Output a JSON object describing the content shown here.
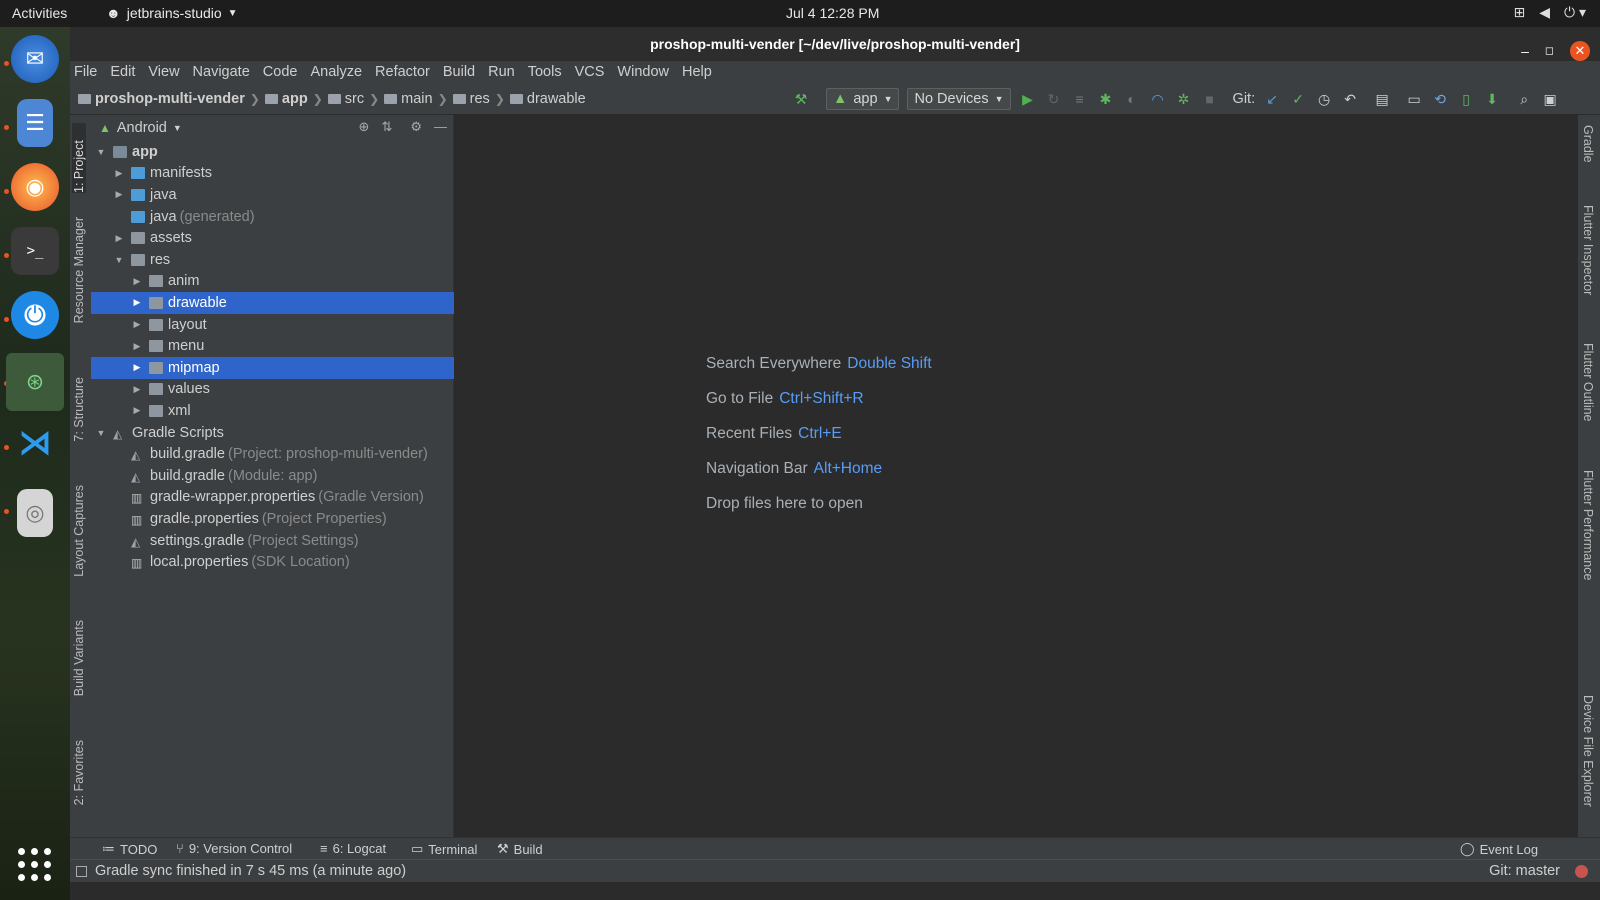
{
  "system": {
    "activities": "Activities",
    "app_name": "jetbrains-studio",
    "clock": "Jul 4  12:28 PM"
  },
  "window": {
    "title": "proshop-multi-vender [~/dev/live/proshop-multi-vender]"
  },
  "menubar": [
    "File",
    "Edit",
    "View",
    "Navigate",
    "Code",
    "Analyze",
    "Refactor",
    "Build",
    "Run",
    "Tools",
    "VCS",
    "Window",
    "Help"
  ],
  "breadcrumb": [
    "proshop-multi-vender",
    "app",
    "src",
    "main",
    "res",
    "drawable"
  ],
  "toolbar": {
    "run_config": "app",
    "device": "No Devices",
    "git_label": "Git:"
  },
  "left_tabs": [
    "1: Project",
    "Resource Manager",
    "7: Structure",
    "Layout Captures",
    "Build Variants",
    "2: Favorites"
  ],
  "right_tabs": [
    "Gradle",
    "Flutter Inspector",
    "Flutter Outline",
    "Flutter Performance",
    "Device File Explorer"
  ],
  "project": {
    "view_mode": "Android",
    "tree": [
      {
        "label": "app",
        "hint": "",
        "depth": 0,
        "arrow": "down",
        "icon": "folder-app",
        "selected": false,
        "bold": true
      },
      {
        "label": "manifests",
        "hint": "",
        "depth": 1,
        "arrow": "right",
        "icon": "folder-blue",
        "selected": false
      },
      {
        "label": "java",
        "hint": "",
        "depth": 1,
        "arrow": "right",
        "icon": "folder-blue",
        "selected": false
      },
      {
        "label": "java",
        "hint": "(generated)",
        "depth": 1,
        "arrow": "",
        "icon": "folder-blue",
        "selected": false
      },
      {
        "label": "assets",
        "hint": "",
        "depth": 1,
        "arrow": "right",
        "icon": "folder",
        "selected": false
      },
      {
        "label": "res",
        "hint": "",
        "depth": 1,
        "arrow": "down",
        "icon": "folder",
        "selected": false
      },
      {
        "label": "anim",
        "hint": "",
        "depth": 2,
        "arrow": "right",
        "icon": "folder",
        "selected": false
      },
      {
        "label": "drawable",
        "hint": "",
        "depth": 2,
        "arrow": "right",
        "icon": "folder",
        "selected": true
      },
      {
        "label": "layout",
        "hint": "",
        "depth": 2,
        "arrow": "right",
        "icon": "folder",
        "selected": false
      },
      {
        "label": "menu",
        "hint": "",
        "depth": 2,
        "arrow": "right",
        "icon": "folder",
        "selected": false
      },
      {
        "label": "mipmap",
        "hint": "",
        "depth": 2,
        "arrow": "right",
        "icon": "folder",
        "selected": true
      },
      {
        "label": "values",
        "hint": "",
        "depth": 2,
        "arrow": "right",
        "icon": "folder",
        "selected": false
      },
      {
        "label": "xml",
        "hint": "",
        "depth": 2,
        "arrow": "right",
        "icon": "folder",
        "selected": false
      },
      {
        "label": "Gradle Scripts",
        "hint": "",
        "depth": 0,
        "arrow": "down",
        "icon": "gradle",
        "selected": false
      },
      {
        "label": "build.gradle",
        "hint": "(Project: proshop-multi-vender)",
        "depth": 1,
        "arrow": "",
        "icon": "gradle",
        "selected": false
      },
      {
        "label": "build.gradle",
        "hint": "(Module: app)",
        "depth": 1,
        "arrow": "",
        "icon": "gradle",
        "selected": false
      },
      {
        "label": "gradle-wrapper.properties",
        "hint": "(Gradle Version)",
        "depth": 1,
        "arrow": "",
        "icon": "props",
        "selected": false
      },
      {
        "label": "gradle.properties",
        "hint": "(Project Properties)",
        "depth": 1,
        "arrow": "",
        "icon": "props",
        "selected": false
      },
      {
        "label": "settings.gradle",
        "hint": "(Project Settings)",
        "depth": 1,
        "arrow": "",
        "icon": "gradle",
        "selected": false
      },
      {
        "label": "local.properties",
        "hint": "(SDK Location)",
        "depth": 1,
        "arrow": "",
        "icon": "props",
        "selected": false
      }
    ]
  },
  "editor_tips": [
    {
      "label": "Search Everywhere",
      "key": "Double Shift"
    },
    {
      "label": "Go to File",
      "key": "Ctrl+Shift+R"
    },
    {
      "label": "Recent Files",
      "key": "Ctrl+E"
    },
    {
      "label": "Navigation Bar",
      "key": "Alt+Home"
    },
    {
      "label": "Drop files here to open",
      "key": ""
    }
  ],
  "bottom_tabs": [
    "TODO",
    "9: Version Control",
    "6: Logcat",
    "Terminal",
    "Build"
  ],
  "event_log": "Event Log",
  "status": {
    "message": "Gradle sync finished in 7 s 45 ms (a minute ago)",
    "git": "Git: master"
  }
}
